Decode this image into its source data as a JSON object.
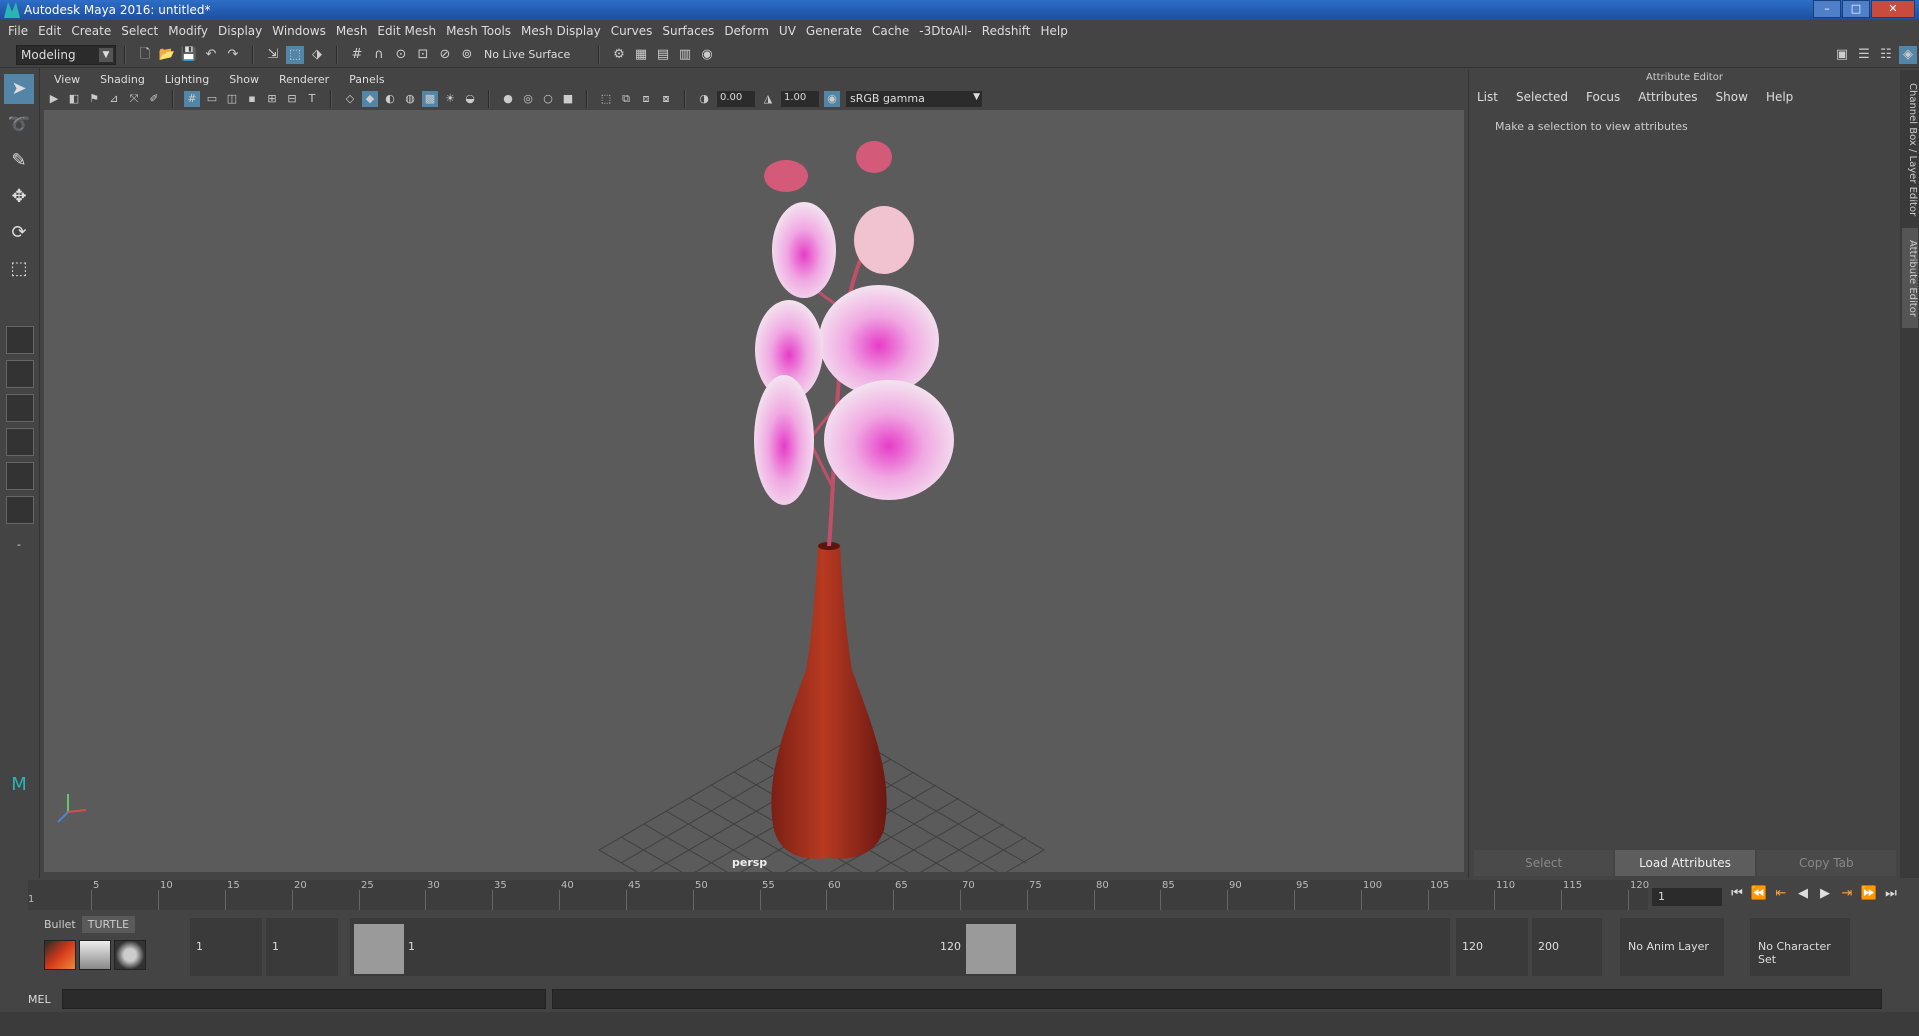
{
  "window": {
    "title": "Autodesk Maya 2016: untitled*"
  },
  "menubar": [
    "File",
    "Edit",
    "Create",
    "Select",
    "Modify",
    "Display",
    "Windows",
    "Mesh",
    "Edit Mesh",
    "Mesh Tools",
    "Mesh Display",
    "Curves",
    "Surfaces",
    "Deform",
    "UV",
    "Generate",
    "Cache",
    "-3DtoAll-",
    "Redshift",
    "Help"
  ],
  "status_line": {
    "mode": "Modeling",
    "live_surface": "No Live Surface"
  },
  "viewport": {
    "menu": [
      "View",
      "Shading",
      "Lighting",
      "Show",
      "Renderer",
      "Panels"
    ],
    "exposure": "0.00",
    "gamma": "1.00",
    "color_space": "sRGB gamma",
    "camera": "persp",
    "colors": {
      "background": "#5b5b5b",
      "vase": "#a8321e",
      "petal": "#f4e4ef",
      "petal_center": "#e63cc8",
      "bud": "#d45a7a"
    }
  },
  "attribute_editor": {
    "title": "Attribute Editor",
    "menu": [
      "List",
      "Selected",
      "Focus",
      "Attributes",
      "Show",
      "Help"
    ],
    "message": "Make a selection to view attributes",
    "buttons": {
      "select": "Select",
      "load": "Load Attributes",
      "copy": "Copy Tab"
    }
  },
  "side_tabs": {
    "channel_box": "Channel Box / Layer Editor",
    "attribute_editor": "Attribute Editor"
  },
  "time_slider": {
    "start_label": "1",
    "ticks": [
      "5",
      "10",
      "15",
      "20",
      "25",
      "30",
      "35",
      "40",
      "45",
      "50",
      "55",
      "60",
      "65",
      "70",
      "75",
      "80",
      "85",
      "90",
      "95",
      "100",
      "105",
      "110",
      "115",
      "120"
    ],
    "current_frame": "1"
  },
  "range_slider": {
    "start": "1",
    "playback_start": "1",
    "range_start_label": "1",
    "range_end_label": "120",
    "playback_end": "120",
    "end": "200",
    "anim_layer": "No Anim Layer",
    "character_set": "No Character Set"
  },
  "shelf": {
    "tabs": [
      "Bullet",
      "TURTLE"
    ]
  },
  "command_line": {
    "label": "MEL"
  }
}
